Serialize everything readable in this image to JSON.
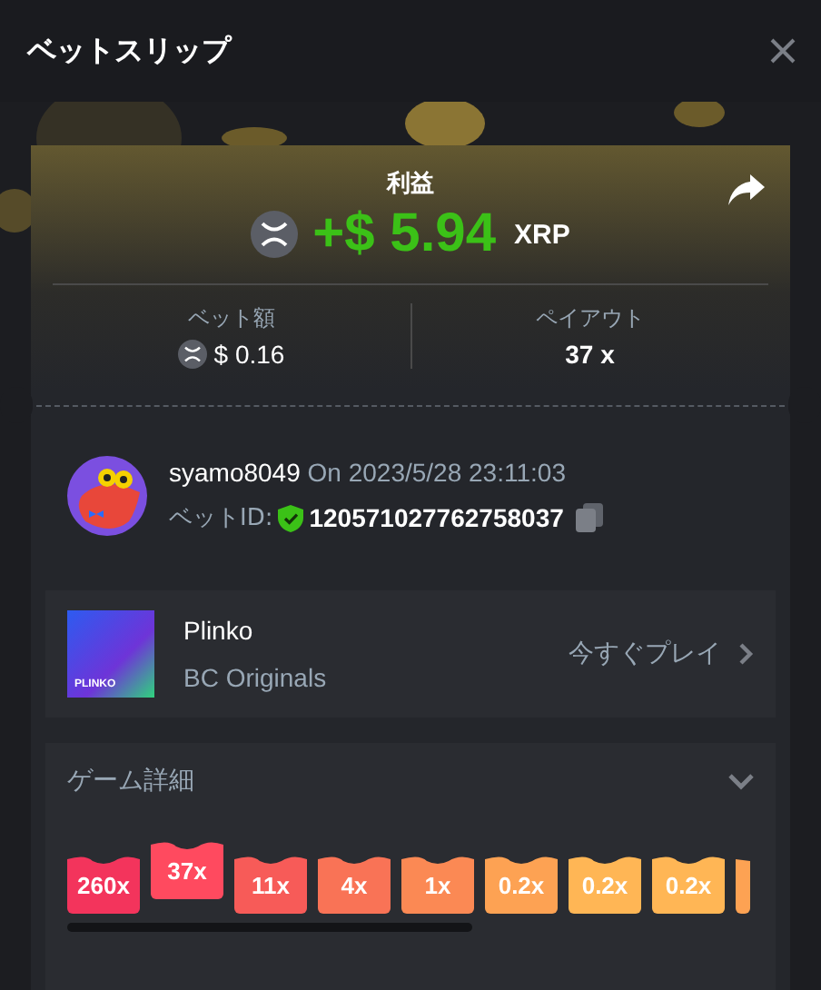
{
  "header": {
    "title": "ベットスリップ"
  },
  "profit": {
    "label": "利益",
    "amount": "+$ 5.94",
    "currency": "XRP"
  },
  "stats": [
    {
      "label": "ベット額",
      "value": "$ 0.16",
      "coin": true
    },
    {
      "label": "ペイアウト",
      "value": "37 x",
      "coin": false
    }
  ],
  "player": {
    "name": "syamo8049",
    "time": "On 2023/5/28 23:11:03",
    "bet_id_label": "ベットID:",
    "bet_id": "120571027762758037"
  },
  "game": {
    "name": "Plinko",
    "provider": "BC Originals",
    "thumb_text": "PLINKO",
    "play": "今すぐプレイ"
  },
  "details": {
    "title": "ゲーム詳細",
    "expanded": false,
    "buckets": [
      {
        "label": "260x",
        "color": "#f3345c",
        "selected": false
      },
      {
        "label": "37x",
        "color": "#f5465a",
        "selected": true
      },
      {
        "label": "11x",
        "color": "#f75b58",
        "selected": false
      },
      {
        "label": "4x",
        "color": "#f97356",
        "selected": false
      },
      {
        "label": "1x",
        "color": "#fb8954",
        "selected": false
      },
      {
        "label": "0.2x",
        "color": "#fda253",
        "selected": false
      },
      {
        "label": "0.2x",
        "color": "#ffb655",
        "selected": false
      },
      {
        "label": "0.2x",
        "color": "#ffb655",
        "selected": false
      },
      {
        "color": "#fda253",
        "selected": false
      }
    ]
  }
}
